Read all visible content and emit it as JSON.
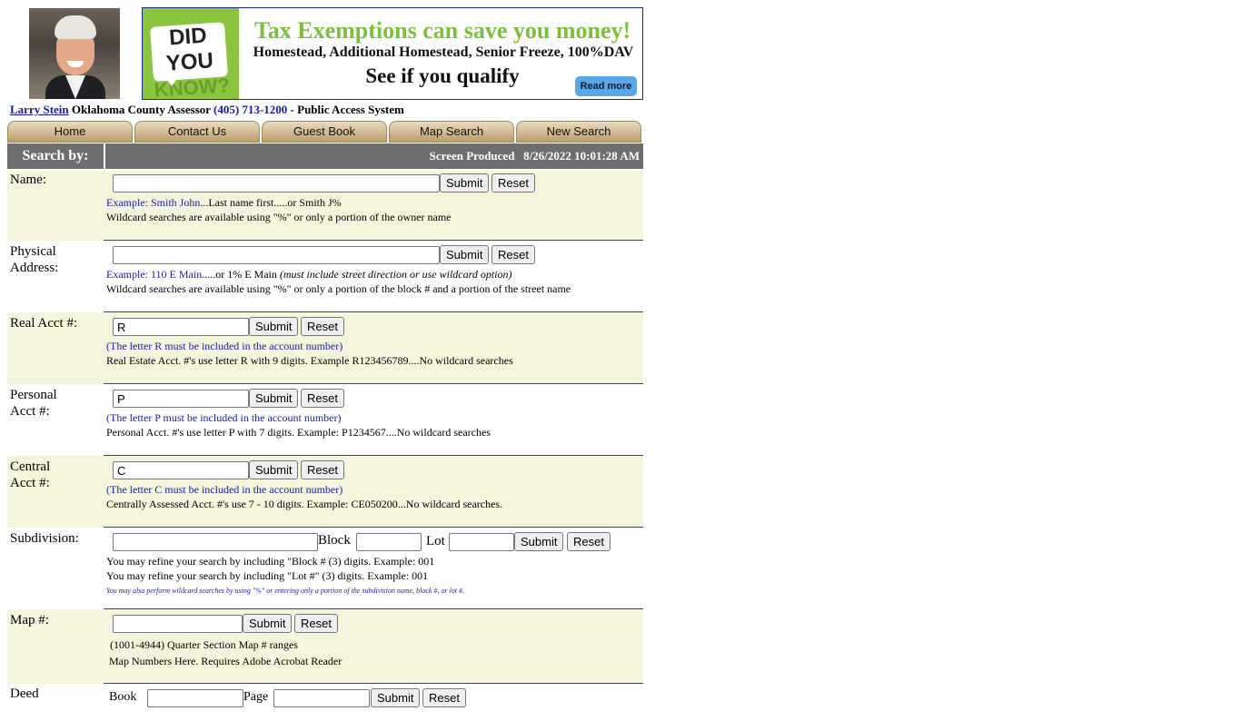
{
  "header": {
    "photo_alt": "Larry Stein portrait",
    "banner": {
      "did_you_know_1": "DID YOU",
      "did_you_know_2": "KNOW?",
      "line1": "Tax Exemptions can save you money!",
      "line2": "Homestead, Additional Homestead, Senior Freeze, 100%DAV",
      "line3": "See if you qualify",
      "button": "Read more"
    },
    "info": {
      "name_link": "Larry Stein",
      "office": " Oklahoma County Assessor ",
      "phone": "(405) 713-1200",
      "suffix": " - Public Access System"
    }
  },
  "nav": [
    "Home",
    "Contact Us",
    "Guest Book",
    "Map Search",
    "New Search"
  ],
  "table": {
    "search_by": "Search by:",
    "screen_produced": "Screen Produced   8/26/2022 10:01:28 AM"
  },
  "buttons": {
    "submit": "Submit",
    "reset": "Reset"
  },
  "name": {
    "label": "Name:",
    "value": "",
    "example_blue": "Example: Smith John",
    "example_rest": "...Last name first.....or Smith J%",
    "wildcard": "Wildcard searches are available using \"%\" or only a portion of the owner name"
  },
  "address": {
    "label_1": "Physical",
    "label_2": "Address:",
    "value": "",
    "example_blue": "Example: 110 E Main",
    "example_rest": ".....or 1% E Main ",
    "example_italic": "(must include street direction or use wildcard option)",
    "wildcard": "Wildcard searches are available using \"%\" or only a portion of the block # and a portion of the street name"
  },
  "real": {
    "label": "Real Acct #:",
    "value": "R",
    "note_blue": "(The letter R must be included in the account number)",
    "note": "Real Estate Acct. #'s use letter R with 9 digits.   Example R123456789....No wildcard searches"
  },
  "personal": {
    "label_1": "Personal",
    "label_2": "Acct #:",
    "value": "P",
    "note_blue": "(The letter P must be included in the account number)",
    "note": "Personal Acct. #'s use letter P with 7 digits.  Example: P1234567....No wildcard searches"
  },
  "central": {
    "label_1": "Central",
    "label_2": "Acct #:",
    "value": "C",
    "note_blue": "(The letter C must be included in the account number)",
    "note": "Centrally Assessed Acct. #'s use 7 - 10 digits.  Example: CE050200...No wildcard searches."
  },
  "subdivision": {
    "label": "Subdivision:",
    "block_label": "Block",
    "lot_label": "Lot",
    "note1": "You may refine your search by including \"Block # (3) digits.  Example: 001",
    "note2": "You may refine your search by including \"Lot #\" (3) digits.  Example:  001",
    "note3": "You may also perform wildcard searches by using \"%\" or entering only a portion of the subdivision name, block #, or lot #."
  },
  "map": {
    "label": "Map #:",
    "note1": "(1001-4944) Quarter Section Map # ranges",
    "note2": "Map Numbers Here.  Requires Adobe Acrobat Reader"
  },
  "deed": {
    "label": "Deed",
    "book_label": "Book",
    "page_label": "Page"
  }
}
